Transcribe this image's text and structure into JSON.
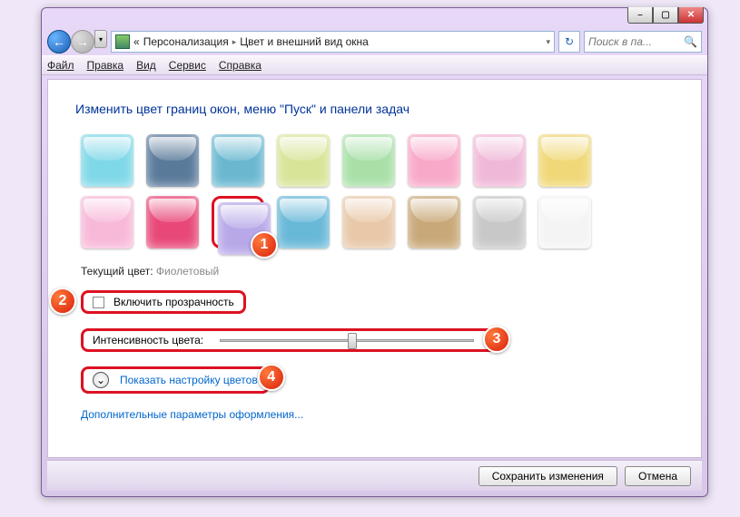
{
  "breadcrumb": {
    "prefix": "«",
    "item1": "Персонализация",
    "item2": "Цвет и внешний вид окна"
  },
  "search": {
    "placeholder": "Поиск в па..."
  },
  "menu": {
    "file": "Файл",
    "edit": "Правка",
    "view": "Вид",
    "tools": "Сервис",
    "help": "Справка"
  },
  "heading": "Изменить цвет границ окон, меню \"Пуск\" и панели задач",
  "swatches": [
    {
      "bg": "#7fd8e8"
    },
    {
      "bg": "#5a7a9a"
    },
    {
      "bg": "#6ab8d0"
    },
    {
      "bg": "#d8e498"
    },
    {
      "bg": "#a8e0a8"
    },
    {
      "bg": "#f8a8c8"
    },
    {
      "bg": "#f0b8d8"
    },
    {
      "bg": "#f0d878"
    },
    {
      "bg": "#f8b8d8"
    },
    {
      "bg": "#e84878"
    },
    {
      "bg": "#b8a8e8",
      "selected": true
    },
    {
      "bg": "#68b8d8"
    },
    {
      "bg": "#e8c8a8"
    },
    {
      "bg": "#c8a878"
    },
    {
      "bg": "#c8c8c8"
    },
    {
      "bg": "#f4f4f4"
    }
  ],
  "current": {
    "label": "Текущий цвет: ",
    "value": "Фиолетовый"
  },
  "transparency": {
    "label": "Включить прозрачность"
  },
  "intensity": {
    "label": "Интенсивность цвета:",
    "value": 50
  },
  "expand": {
    "label": "Показать настройку цветов"
  },
  "advanced_link": "Дополнительные параметры оформления...",
  "footer": {
    "save": "Сохранить изменения",
    "cancel": "Отмена"
  },
  "badges": [
    "1",
    "2",
    "3",
    "4"
  ]
}
